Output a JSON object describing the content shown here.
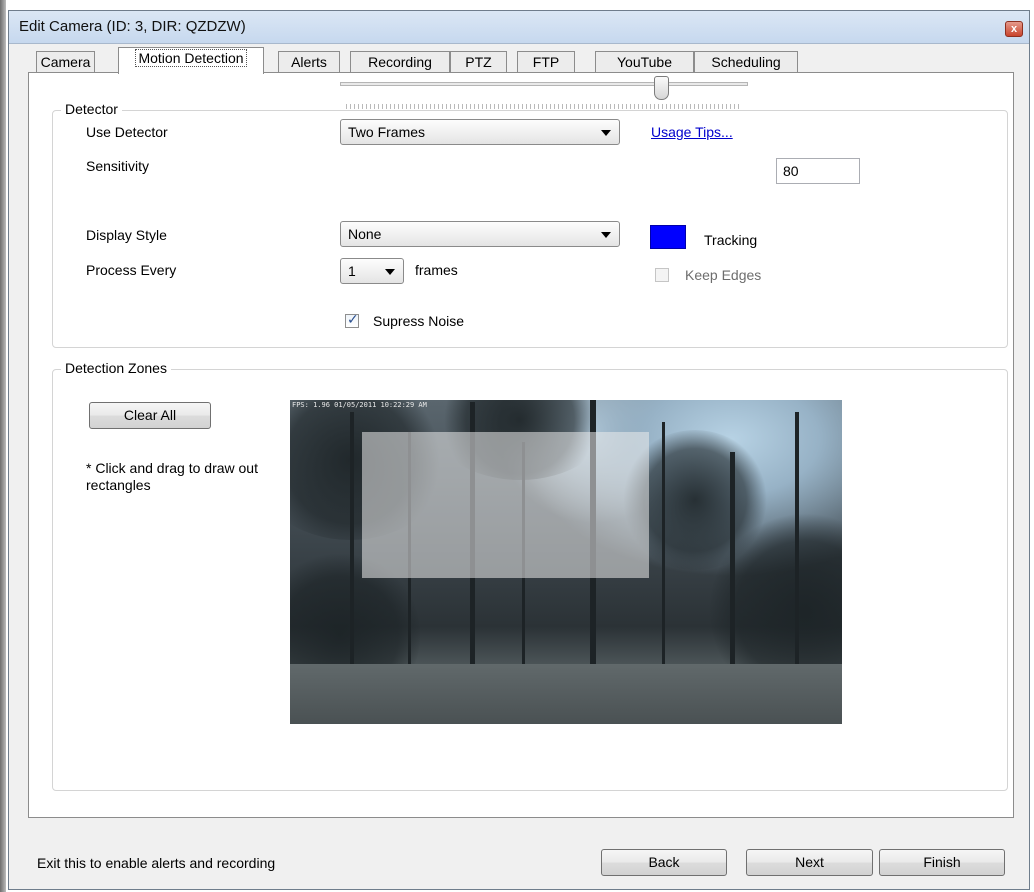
{
  "window": {
    "title": "Edit Camera (ID: 3, DIR: QZDZW)",
    "close_glyph": "x"
  },
  "tabs": [
    {
      "label": "Camera"
    },
    {
      "label": "Motion Detection",
      "active": true
    },
    {
      "label": "Alerts"
    },
    {
      "label": "Recording"
    },
    {
      "label": "PTZ"
    },
    {
      "label": "FTP"
    },
    {
      "label": "YouTube"
    },
    {
      "label": "Scheduling"
    }
  ],
  "detector": {
    "group_title": "Detector",
    "use_detector_label": "Use Detector",
    "use_detector_value": "Two Frames",
    "usage_tips": "Usage Tips...",
    "sensitivity_label": "Sensitivity",
    "sensitivity_value": "80",
    "sensitivity_level": 80,
    "display_style_label": "Display Style",
    "display_style_value": "None",
    "tracking_color": "#0000ff",
    "tracking_label": "Tracking",
    "process_every_label": "Process Every",
    "process_every_value": "1",
    "frames_label": "frames",
    "keep_edges_label": "Keep Edges",
    "keep_edges_checked": false,
    "supress_noise_label": "Supress Noise",
    "supress_noise_checked": true
  },
  "zones": {
    "group_title": "Detection Zones",
    "clear_all": "Clear All",
    "hint": "* Click and drag to draw out rectangles",
    "preview_overlay": "FPS: 1.96 01/05/2011 10:22:29 AM"
  },
  "footer": {
    "status": "Exit this to enable alerts and recording",
    "back": "Back",
    "next": "Next",
    "finish": "Finish"
  }
}
